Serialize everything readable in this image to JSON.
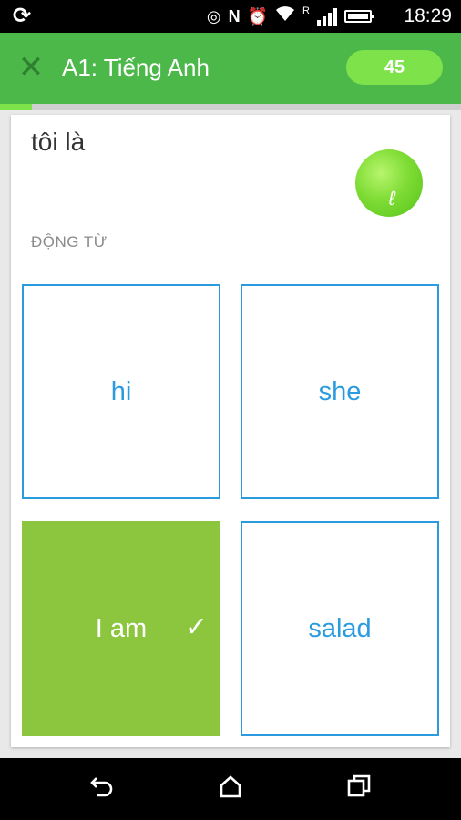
{
  "status_bar": {
    "time": "18:29",
    "icons": [
      "sync-icon",
      "location-icon",
      "nfc-icon",
      "alarm-icon",
      "wifi-icon",
      "signal-icon",
      "battery-icon"
    ],
    "roaming": "R"
  },
  "app_bar": {
    "title": "A1: Tiếng Anh",
    "score": "45",
    "progress": 0.07,
    "colors": {
      "bar": "#4cb84a",
      "accent": "#7ee24a"
    }
  },
  "exercise": {
    "prompt": "tôi là",
    "category": "ĐỘNG TỪ",
    "options": [
      {
        "label": "hi",
        "selected": false
      },
      {
        "label": "she",
        "selected": false
      },
      {
        "label": "I am",
        "selected": true
      },
      {
        "label": "salad",
        "selected": false
      }
    ],
    "colors": {
      "option_border": "#2b9be0",
      "selected_fill": "#8cc63f"
    }
  },
  "nav_bar": {
    "icons": [
      "back-icon",
      "home-icon",
      "recents-icon"
    ]
  }
}
